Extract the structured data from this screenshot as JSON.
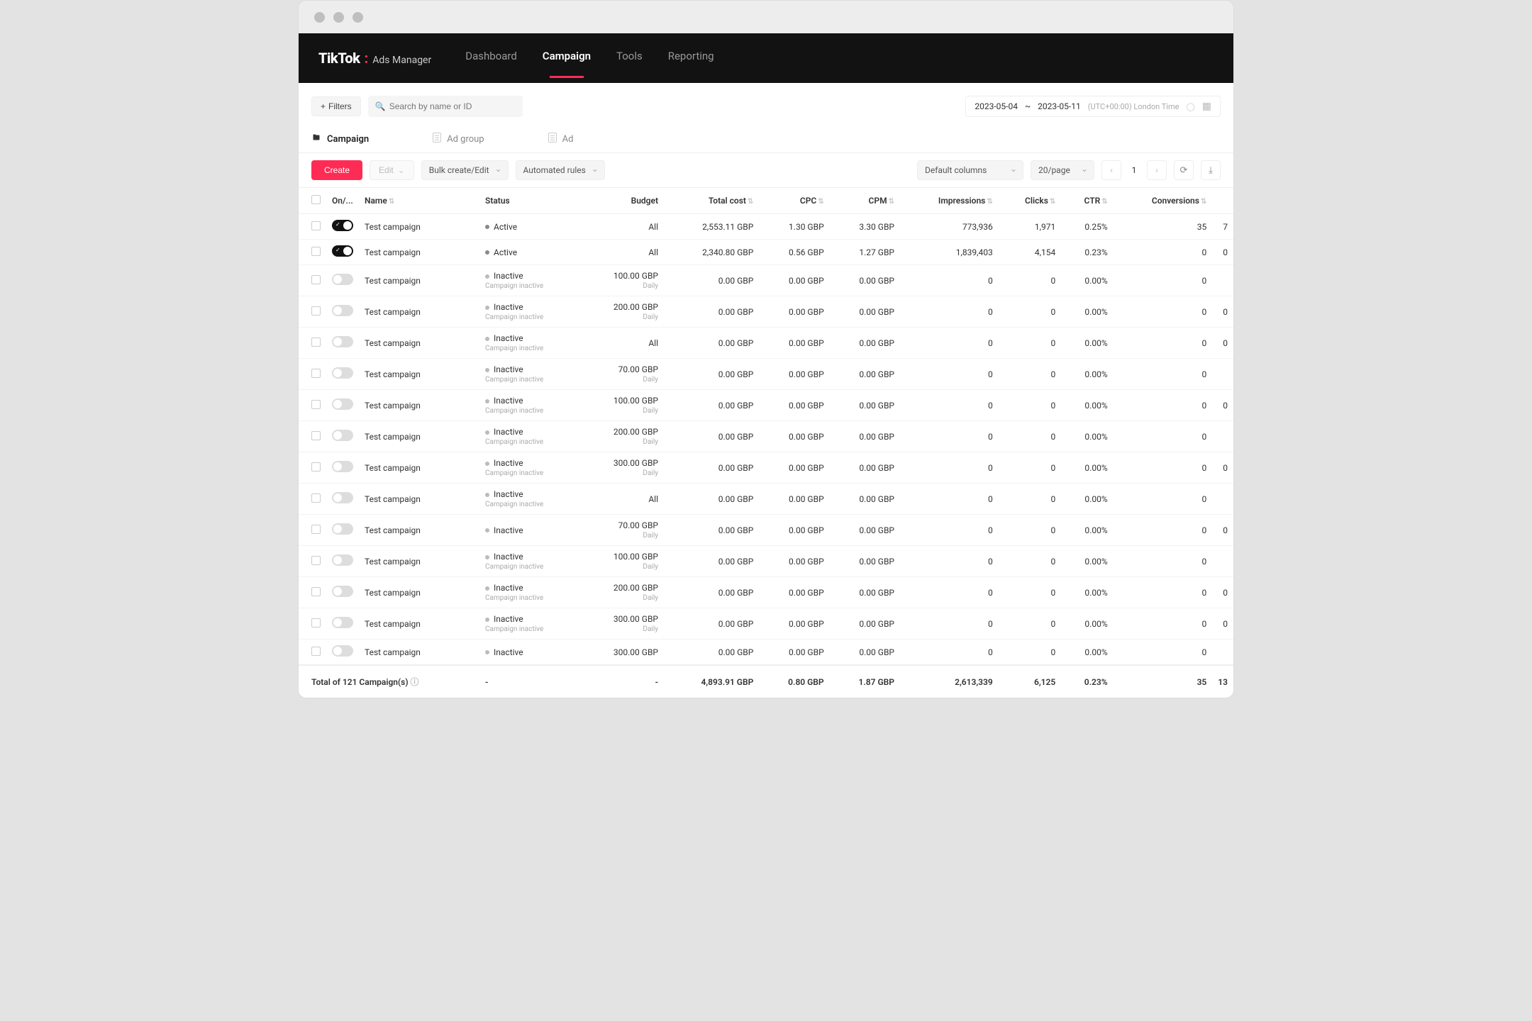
{
  "window": {
    "dot_count": 3
  },
  "header": {
    "logo_main": "TikTok",
    "logo_sub": "Ads Manager",
    "nav": [
      {
        "label": "Dashboard",
        "active": false
      },
      {
        "label": "Campaign",
        "active": true
      },
      {
        "label": "Tools",
        "active": false
      },
      {
        "label": "Reporting",
        "active": false
      }
    ]
  },
  "toolbar": {
    "filters_label": "Filters",
    "search_placeholder": "Search by name or ID",
    "date_start": "2023-05-04",
    "date_sep": "~",
    "date_end": "2023-05-11",
    "timezone": "(UTC+00:00) London Time"
  },
  "level_tabs": [
    {
      "label": "Campaign",
      "active": true,
      "icon": "folder"
    },
    {
      "label": "Ad group",
      "active": false,
      "icon": "doc"
    },
    {
      "label": "Ad",
      "active": false,
      "icon": "doc"
    }
  ],
  "actions": {
    "create": "Create",
    "edit": "Edit",
    "bulk": "Bulk create/Edit",
    "rules": "Automated rules",
    "columns_select": "Default columns",
    "page_size": "20/page",
    "page_number": "1"
  },
  "columns": [
    {
      "key": "cb",
      "label": "",
      "sortable": false,
      "align": "left"
    },
    {
      "key": "onoff",
      "label": "On/...",
      "sortable": false,
      "align": "left"
    },
    {
      "key": "name",
      "label": "Name",
      "sortable": true,
      "align": "left"
    },
    {
      "key": "status",
      "label": "Status",
      "sortable": false,
      "align": "left"
    },
    {
      "key": "budget",
      "label": "Budget",
      "sortable": false,
      "align": "right"
    },
    {
      "key": "total_cost",
      "label": "Total cost",
      "sortable": true,
      "align": "right"
    },
    {
      "key": "cpc",
      "label": "CPC",
      "sortable": true,
      "align": "right"
    },
    {
      "key": "cpm",
      "label": "CPM",
      "sortable": true,
      "align": "right"
    },
    {
      "key": "impressions",
      "label": "Impressions",
      "sortable": true,
      "align": "right"
    },
    {
      "key": "clicks",
      "label": "Clicks",
      "sortable": true,
      "align": "right"
    },
    {
      "key": "ctr",
      "label": "CTR",
      "sortable": true,
      "align": "right"
    },
    {
      "key": "conversions",
      "label": "Conversions",
      "sortable": true,
      "align": "right"
    },
    {
      "key": "extra",
      "label": "",
      "sortable": false,
      "align": "right"
    }
  ],
  "rows": [
    {
      "on": true,
      "name": "Test campaign",
      "status": "Active",
      "status_sub": "",
      "budget": "All",
      "budget_sub": "",
      "total_cost": "2,553.11 GBP",
      "cpc": "1.30 GBP",
      "cpm": "3.30 GBP",
      "impressions": "773,936",
      "clicks": "1,971",
      "ctr": "0.25%",
      "conversions": "35",
      "extra": "7"
    },
    {
      "on": true,
      "name": "Test campaign",
      "status": "Active",
      "status_sub": "",
      "budget": "All",
      "budget_sub": "",
      "total_cost": "2,340.80 GBP",
      "cpc": "0.56 GBP",
      "cpm": "1.27 GBP",
      "impressions": "1,839,403",
      "clicks": "4,154",
      "ctr": "0.23%",
      "conversions": "0",
      "extra": "0"
    },
    {
      "on": false,
      "name": "Test campaign",
      "status": "Inactive",
      "status_sub": "Campaign inactive",
      "budget": "100.00 GBP",
      "budget_sub": "Daily",
      "total_cost": "0.00 GBP",
      "cpc": "0.00 GBP",
      "cpm": "0.00 GBP",
      "impressions": "0",
      "clicks": "0",
      "ctr": "0.00%",
      "conversions": "0",
      "extra": ""
    },
    {
      "on": false,
      "name": "Test campaign",
      "status": "Inactive",
      "status_sub": "Campaign inactive",
      "budget": "200.00 GBP",
      "budget_sub": "Daily",
      "total_cost": "0.00 GBP",
      "cpc": "0.00 GBP",
      "cpm": "0.00 GBP",
      "impressions": "0",
      "clicks": "0",
      "ctr": "0.00%",
      "conversions": "0",
      "extra": "0"
    },
    {
      "on": false,
      "name": "Test campaign",
      "status": "Inactive",
      "status_sub": "Campaign inactive",
      "budget": "All",
      "budget_sub": "",
      "total_cost": "0.00 GBP",
      "cpc": "0.00 GBP",
      "cpm": "0.00 GBP",
      "impressions": "0",
      "clicks": "0",
      "ctr": "0.00%",
      "conversions": "0",
      "extra": "0"
    },
    {
      "on": false,
      "name": "Test campaign",
      "status": "Inactive",
      "status_sub": "Campaign inactive",
      "budget": "70.00 GBP",
      "budget_sub": "Daily",
      "total_cost": "0.00 GBP",
      "cpc": "0.00 GBP",
      "cpm": "0.00 GBP",
      "impressions": "0",
      "clicks": "0",
      "ctr": "0.00%",
      "conversions": "0",
      "extra": ""
    },
    {
      "on": false,
      "name": "Test campaign",
      "status": "Inactive",
      "status_sub": "Campaign inactive",
      "budget": "100.00 GBP",
      "budget_sub": "Daily",
      "total_cost": "0.00 GBP",
      "cpc": "0.00 GBP",
      "cpm": "0.00 GBP",
      "impressions": "0",
      "clicks": "0",
      "ctr": "0.00%",
      "conversions": "0",
      "extra": "0"
    },
    {
      "on": false,
      "name": "Test campaign",
      "status": "Inactive",
      "status_sub": "Campaign inactive",
      "budget": "200.00 GBP",
      "budget_sub": "Daily",
      "total_cost": "0.00 GBP",
      "cpc": "0.00 GBP",
      "cpm": "0.00 GBP",
      "impressions": "0",
      "clicks": "0",
      "ctr": "0.00%",
      "conversions": "0",
      "extra": ""
    },
    {
      "on": false,
      "name": "Test campaign",
      "status": "Inactive",
      "status_sub": "Campaign inactive",
      "budget": "300.00 GBP",
      "budget_sub": "Daily",
      "total_cost": "0.00 GBP",
      "cpc": "0.00 GBP",
      "cpm": "0.00 GBP",
      "impressions": "0",
      "clicks": "0",
      "ctr": "0.00%",
      "conversions": "0",
      "extra": "0"
    },
    {
      "on": false,
      "name": "Test campaign",
      "status": "Inactive",
      "status_sub": "Campaign inactive",
      "budget": "All",
      "budget_sub": "",
      "total_cost": "0.00 GBP",
      "cpc": "0.00 GBP",
      "cpm": "0.00 GBP",
      "impressions": "0",
      "clicks": "0",
      "ctr": "0.00%",
      "conversions": "0",
      "extra": ""
    },
    {
      "on": false,
      "name": "Test campaign",
      "status": "Inactive",
      "status_sub": "",
      "budget": "70.00 GBP",
      "budget_sub": "Daily",
      "total_cost": "0.00 GBP",
      "cpc": "0.00 GBP",
      "cpm": "0.00 GBP",
      "impressions": "0",
      "clicks": "0",
      "ctr": "0.00%",
      "conversions": "0",
      "extra": "0"
    },
    {
      "on": false,
      "name": "Test campaign",
      "status": "Inactive",
      "status_sub": "Campaign inactive",
      "budget": "100.00 GBP",
      "budget_sub": "Daily",
      "total_cost": "0.00 GBP",
      "cpc": "0.00 GBP",
      "cpm": "0.00 GBP",
      "impressions": "0",
      "clicks": "0",
      "ctr": "0.00%",
      "conversions": "0",
      "extra": ""
    },
    {
      "on": false,
      "name": "Test campaign",
      "status": "Inactive",
      "status_sub": "Campaign inactive",
      "budget": "200.00 GBP",
      "budget_sub": "Daily",
      "total_cost": "0.00 GBP",
      "cpc": "0.00 GBP",
      "cpm": "0.00 GBP",
      "impressions": "0",
      "clicks": "0",
      "ctr": "0.00%",
      "conversions": "0",
      "extra": "0"
    },
    {
      "on": false,
      "name": "Test campaign",
      "status": "Inactive",
      "status_sub": "Campaign inactive",
      "budget": "300.00 GBP",
      "budget_sub": "Daily",
      "total_cost": "0.00 GBP",
      "cpc": "0.00 GBP",
      "cpm": "0.00 GBP",
      "impressions": "0",
      "clicks": "0",
      "ctr": "0.00%",
      "conversions": "0",
      "extra": "0"
    },
    {
      "on": false,
      "name": "Test campaign",
      "status": "Inactive",
      "status_sub": "",
      "budget": "300.00 GBP",
      "budget_sub": "",
      "total_cost": "0.00 GBP",
      "cpc": "0.00 GBP",
      "cpm": "0.00 GBP",
      "impressions": "0",
      "clicks": "0",
      "ctr": "0.00%",
      "conversions": "0",
      "extra": ""
    }
  ],
  "footer": {
    "label": "Total of 121 Campaign(s)",
    "status": "-",
    "budget": "-",
    "total_cost": "4,893.91 GBP",
    "cpc": "0.80 GBP",
    "cpm": "1.87 GBP",
    "impressions": "2,613,339",
    "clicks": "6,125",
    "ctr": "0.23%",
    "conversions": "35",
    "extra": "13"
  }
}
